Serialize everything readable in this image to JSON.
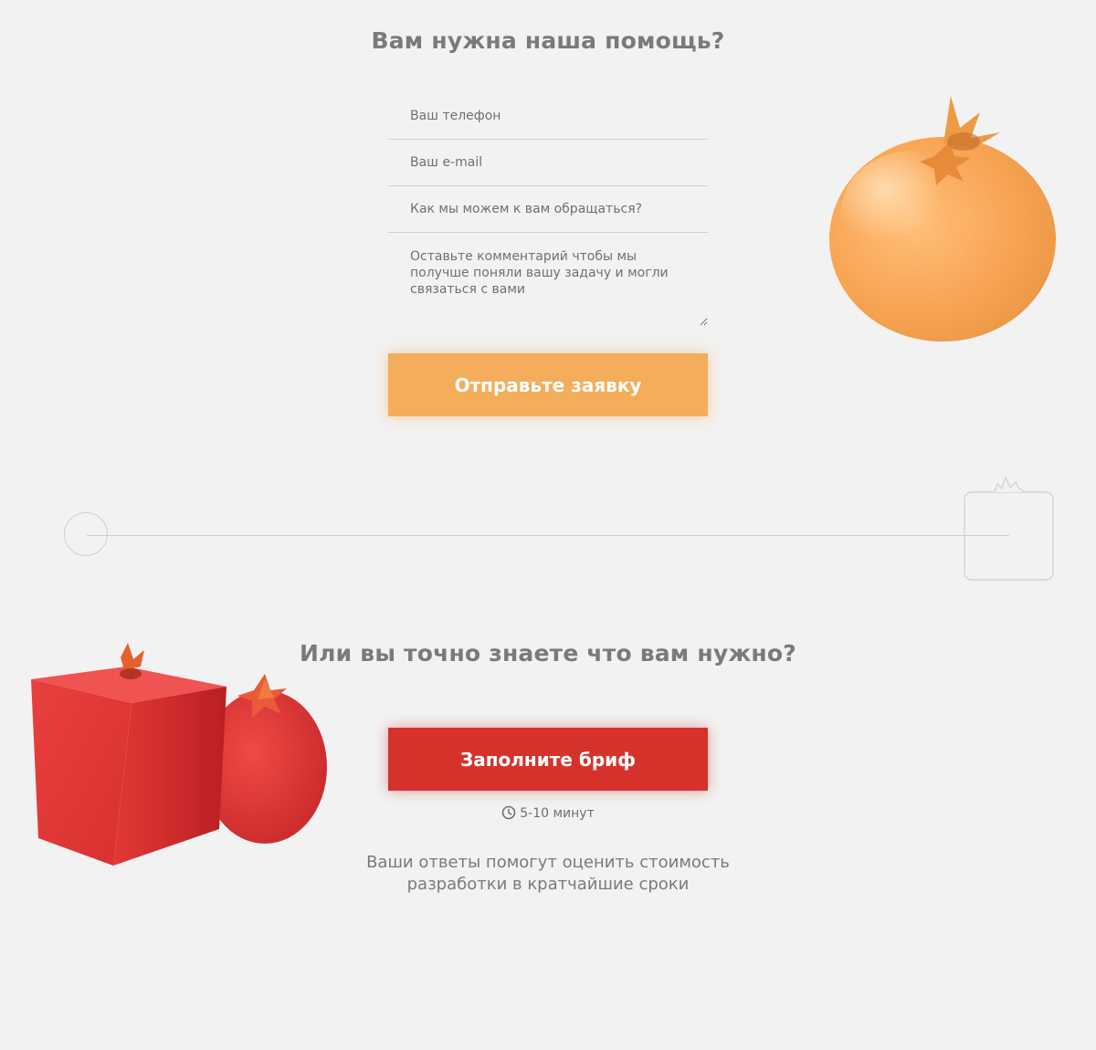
{
  "contact": {
    "title": "Вам нужна наша помощь?",
    "phone_placeholder": "Ваш телефон",
    "email_placeholder": "Ваш e-mail",
    "name_placeholder": "Как мы можем к вам обращаться?",
    "comment_placeholder": "Оставьте комментарий чтобы мы получше поняли вашу задачу и могли связаться с вами",
    "submit_label": "Отправьте заявку"
  },
  "brief": {
    "title": "Или вы точно знаете что вам нужно?",
    "button_label": "Заполните бриф",
    "duration": "5-10 минут",
    "description_line1": "Ваши ответы помогут оценить стоимость",
    "description_line2": "разработки в кратчайшие сроки"
  },
  "icons": {
    "clock": "clock-icon",
    "orange_fruit": "pomegranate-orange-image",
    "cube_fruit": "pomegranate-cube-image",
    "red_fruit": "pomegranate-red-image"
  },
  "colors": {
    "background": "#f2f2f2",
    "submit_button": "#f3ad5b",
    "brief_button": "#d6322c",
    "heading": "#7a7a7a"
  }
}
